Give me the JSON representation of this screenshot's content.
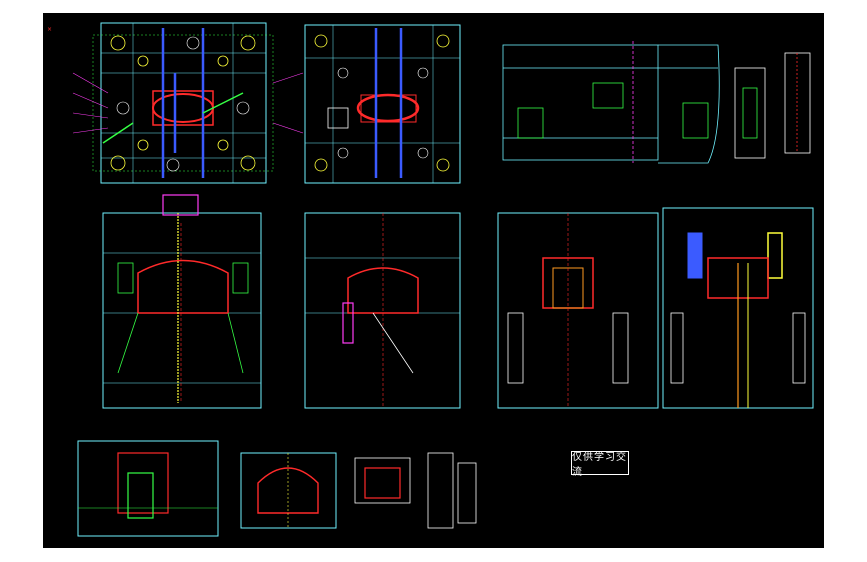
{
  "drawing": {
    "background": "#000000",
    "page_background": "#ffffff",
    "colors": {
      "outline": "#6ff2ff",
      "red": "#ff2a2a",
      "yellow": "#ffff3a",
      "blue": "#3b5bff",
      "magenta": "#ff3df5",
      "green": "#35ff45",
      "white": "#ffffff",
      "orange": "#ff9a1f"
    },
    "note_text": "仅供学习交流",
    "corner_mark": "×"
  }
}
